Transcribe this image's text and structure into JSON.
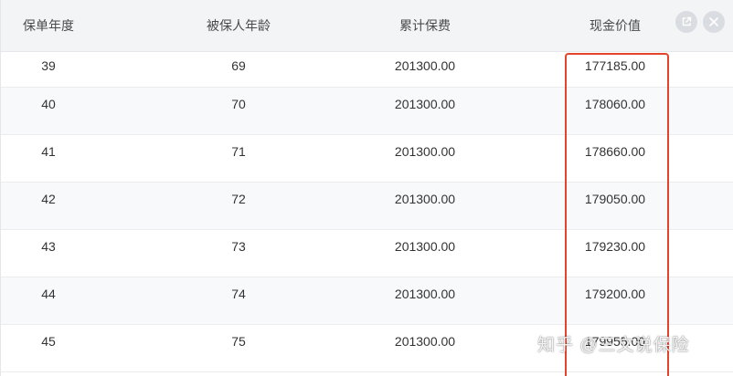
{
  "table": {
    "columns": [
      "保单年度",
      "被保人年龄",
      "累计保费",
      "现金价值"
    ],
    "rows": [
      {
        "year": "39",
        "age": "69",
        "premium": "201300.00",
        "cash_value": "177185.00"
      },
      {
        "year": "40",
        "age": "70",
        "premium": "201300.00",
        "cash_value": "178060.00"
      },
      {
        "year": "41",
        "age": "71",
        "premium": "201300.00",
        "cash_value": "178660.00"
      },
      {
        "year": "42",
        "age": "72",
        "premium": "201300.00",
        "cash_value": "179050.00"
      },
      {
        "year": "43",
        "age": "73",
        "premium": "201300.00",
        "cash_value": "179230.00"
      },
      {
        "year": "44",
        "age": "74",
        "premium": "201300.00",
        "cash_value": "179200.00"
      },
      {
        "year": "45",
        "age": "75",
        "premium": "201300.00",
        "cash_value": "179955.00"
      }
    ]
  },
  "window_controls": {
    "expand_icon": "external-link-icon",
    "close_icon": "close-icon"
  },
  "watermark": {
    "text": "知乎 @三文说保险"
  },
  "colors": {
    "highlight": "#e2442c",
    "header_bg": "#f3f4f6",
    "alt_row_bg": "#f8f9fa"
  }
}
